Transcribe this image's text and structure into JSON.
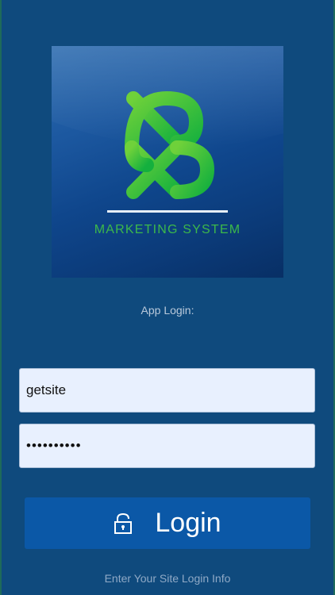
{
  "logo": {
    "brand_text": "MARKETING SYSTEM",
    "icon": "xb-monogram-logo",
    "accent_color": "#3cb84a"
  },
  "login": {
    "heading": "App Login:",
    "username_value": "getsite",
    "password_value": "••••••••••",
    "button_label": "Login",
    "button_icon": "unlock-icon",
    "hint": "Enter Your Site Login Info"
  },
  "colors": {
    "background": "#0f4a7d",
    "button": "#0b58a7",
    "field_background": "#e8f0fe"
  }
}
